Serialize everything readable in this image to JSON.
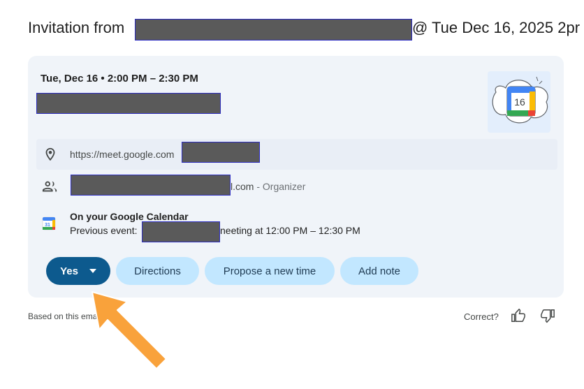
{
  "email": {
    "subject_prefix": "Invitation from",
    "subject_suffix": "@ Tue Dec 16, 2025 2pr"
  },
  "event_card": {
    "date_time": "Tue, Dec 16 • 2:00 PM – 2:30 PM",
    "calendar_illustration_date": "16",
    "location": {
      "icon": "location-pin-icon",
      "url_prefix": "https://meet.google.com"
    },
    "organizer": {
      "icon": "people-icon",
      "email_suffix": "l.com",
      "role": "- Organizer"
    },
    "calendar": {
      "icon": "google-calendar-icon",
      "icon_text": "31",
      "title": "On your Google Calendar",
      "previous_label": "Previous event:",
      "previous_suffix": "neeting at 12:00 PM – 12:30 PM"
    },
    "actions": {
      "rsvp_label": "Yes",
      "directions_label": "Directions",
      "propose_label": "Propose a new time",
      "note_label": "Add note"
    }
  },
  "footer": {
    "based_on": "Based on this ema",
    "correct_question": "Correct?"
  },
  "colors": {
    "card_bg": "#f0f4f9",
    "primary_button": "#0d5a8e",
    "tonal_button": "#c2e7ff",
    "redaction": "#5a5a5a",
    "annotation_arrow": "#f9a23b"
  }
}
